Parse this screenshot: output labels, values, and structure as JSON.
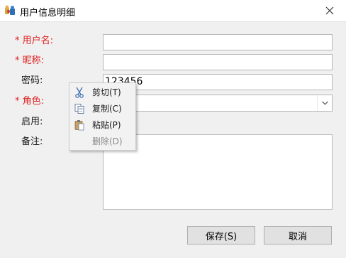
{
  "window": {
    "title": "用户信息明细",
    "close_glyph": "✕"
  },
  "form": {
    "username": {
      "star": "*",
      "label": "用户名:",
      "value": ""
    },
    "nickname": {
      "star": "*",
      "label": "昵称:",
      "value": ""
    },
    "password": {
      "label": "密码:",
      "value": "123456"
    },
    "role": {
      "star": "*",
      "label": "角色:",
      "value": ""
    },
    "enabled": {
      "label": "启用:"
    },
    "notes": {
      "label": "备注:",
      "value": ""
    }
  },
  "buttons": {
    "save": "保存(S)",
    "cancel": "取消"
  },
  "context_menu": {
    "items": [
      {
        "label": "剪切(T)",
        "icon": "scissors-icon"
      },
      {
        "label": "复制(C)",
        "icon": "copy-icon"
      },
      {
        "label": "粘贴(P)",
        "icon": "paste-icon"
      },
      {
        "label": "删除(D)",
        "icon": ""
      }
    ]
  },
  "colors": {
    "required": "#e02020",
    "menu_bg": "#f2f2f2",
    "button_bg": "#e1e1e1"
  }
}
